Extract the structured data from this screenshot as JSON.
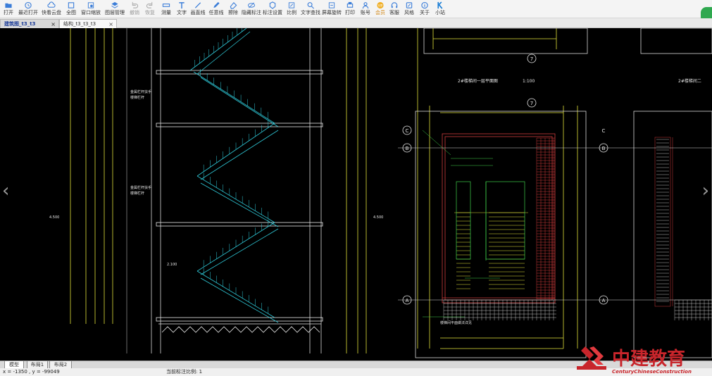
{
  "toolbar": {
    "items": [
      {
        "label": "打开",
        "icon": "folder-open-icon",
        "disabled": false
      },
      {
        "label": "最近打开",
        "icon": "clock-icon",
        "disabled": false
      },
      {
        "label": "快看云盘",
        "icon": "cloud-icon",
        "disabled": false
      },
      {
        "label": "全图",
        "icon": "full-view-icon",
        "disabled": false
      },
      {
        "label": "窗口缩放",
        "icon": "zoom-window-icon",
        "disabled": false
      },
      {
        "label": "图层管理",
        "icon": "layers-icon",
        "disabled": false
      },
      {
        "label": "撤销",
        "icon": "undo-icon",
        "disabled": true
      },
      {
        "label": "恢复",
        "icon": "redo-icon",
        "disabled": true
      },
      {
        "label": "测量",
        "icon": "measure-icon",
        "disabled": false
      },
      {
        "label": "文字",
        "icon": "text-icon",
        "disabled": false
      },
      {
        "label": "画直线",
        "icon": "line-icon",
        "disabled": false
      },
      {
        "label": "任意线",
        "icon": "pen-icon",
        "disabled": false
      },
      {
        "label": "擦除",
        "icon": "eraser-icon",
        "disabled": false
      },
      {
        "label": "隐藏标注",
        "icon": "eye-off-icon",
        "disabled": false
      },
      {
        "label": "标注设置",
        "icon": "settings-icon",
        "disabled": false
      },
      {
        "label": "比例",
        "icon": "scale-icon",
        "disabled": false
      },
      {
        "label": "文字查找",
        "icon": "text-search-icon",
        "disabled": false
      },
      {
        "label": "屏幕旋转",
        "icon": "rotate-icon",
        "disabled": false
      },
      {
        "label": "打印",
        "icon": "print-icon",
        "disabled": false
      },
      {
        "label": "账号",
        "icon": "user-icon",
        "disabled": false
      },
      {
        "label": "会员",
        "icon": "vip-icon",
        "disabled": false,
        "vip": true
      },
      {
        "label": "客服",
        "icon": "headset-icon",
        "disabled": false
      },
      {
        "label": "风格",
        "icon": "palette-icon",
        "disabled": false
      },
      {
        "label": "关于",
        "icon": "info-icon",
        "disabled": false
      },
      {
        "label": "小站",
        "icon": "k-logo-icon",
        "disabled": false
      }
    ]
  },
  "tabs": [
    {
      "label": "建筑图_t3_t3",
      "close": "×",
      "active": true
    },
    {
      "label": "结构_t3_t3_t3",
      "close": "×",
      "active": false
    }
  ],
  "drawing": {
    "titles": [
      "2#楼梯间一层平面图",
      "1:100",
      "2#楼梯间二"
    ],
    "axis_numbers": [
      "7",
      "7",
      "C",
      "B",
      "A",
      "C",
      "B",
      "A"
    ],
    "elevations": [
      "4.500",
      "4.500",
      "2.100",
      "4.500"
    ],
    "notes": [
      "金属栏杆扶手",
      "楼梯栏杆",
      "金属栏杆扶手",
      "楼梯栏杆",
      "楼梯间平面做法详见"
    ]
  },
  "layout_tabs": [
    "模型",
    "布局1",
    "布局2"
  ],
  "status": {
    "coordinates": "x = -1350 , y = -99049",
    "scale": "当前标注比例: 1"
  },
  "watermark": {
    "brand_cn": "中建教育",
    "brand_en": "CenturyChineseConstruction"
  },
  "colors": {
    "canvas": "#000000",
    "cyan": "#2fc9d8",
    "white": "#e8e8e8",
    "yellow": "#e3e33a",
    "green": "#3fd04a",
    "red": "#cc3b3b",
    "brand_red": "#c8252b"
  }
}
